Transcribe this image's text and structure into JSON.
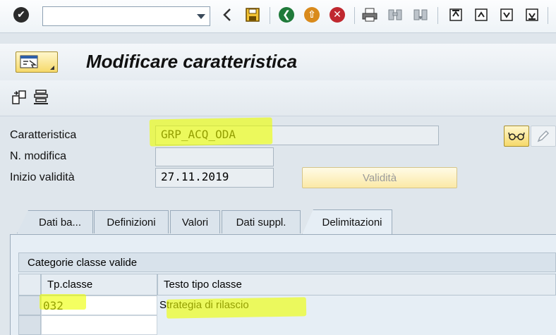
{
  "toolbar": {
    "command_field_value": "",
    "icons": [
      "enter-icon",
      "back-icon",
      "save-icon",
      "back-green-icon",
      "exit-icon",
      "cancel-icon",
      "print-icon",
      "find-icon",
      "find-next-icon",
      "first-page-icon",
      "previous-page-icon",
      "next-page-icon",
      "last-page-icon"
    ]
  },
  "title": "Modificare caratteristica",
  "fields": {
    "caratteristica_label": "Caratteristica",
    "caratteristica_value": "GRP_ACQ_ODA",
    "n_modifica_label": "N. modifica",
    "n_modifica_value": "",
    "inizio_validita_label": "Inizio validità",
    "inizio_validita_value": "27.11.2019",
    "validita_button": "Validità"
  },
  "tabs": [
    {
      "label": "Dati ba..."
    },
    {
      "label": "Definizioni"
    },
    {
      "label": "Valori"
    },
    {
      "label": "Dati suppl."
    },
    {
      "label": "Delimitazioni"
    }
  ],
  "active_tab": "Delimitazioni",
  "table": {
    "title": "Categorie classe valide",
    "columns": [
      "Tp.classe",
      "Testo tipo classe"
    ],
    "rows": [
      {
        "tp_classe": "032",
        "testo": "Strategia di rilascio"
      },
      {
        "tp_classe": "",
        "testo": ""
      }
    ]
  },
  "colors": {
    "highlight": "#eeff00",
    "button_yellow": "#f6d96a"
  }
}
